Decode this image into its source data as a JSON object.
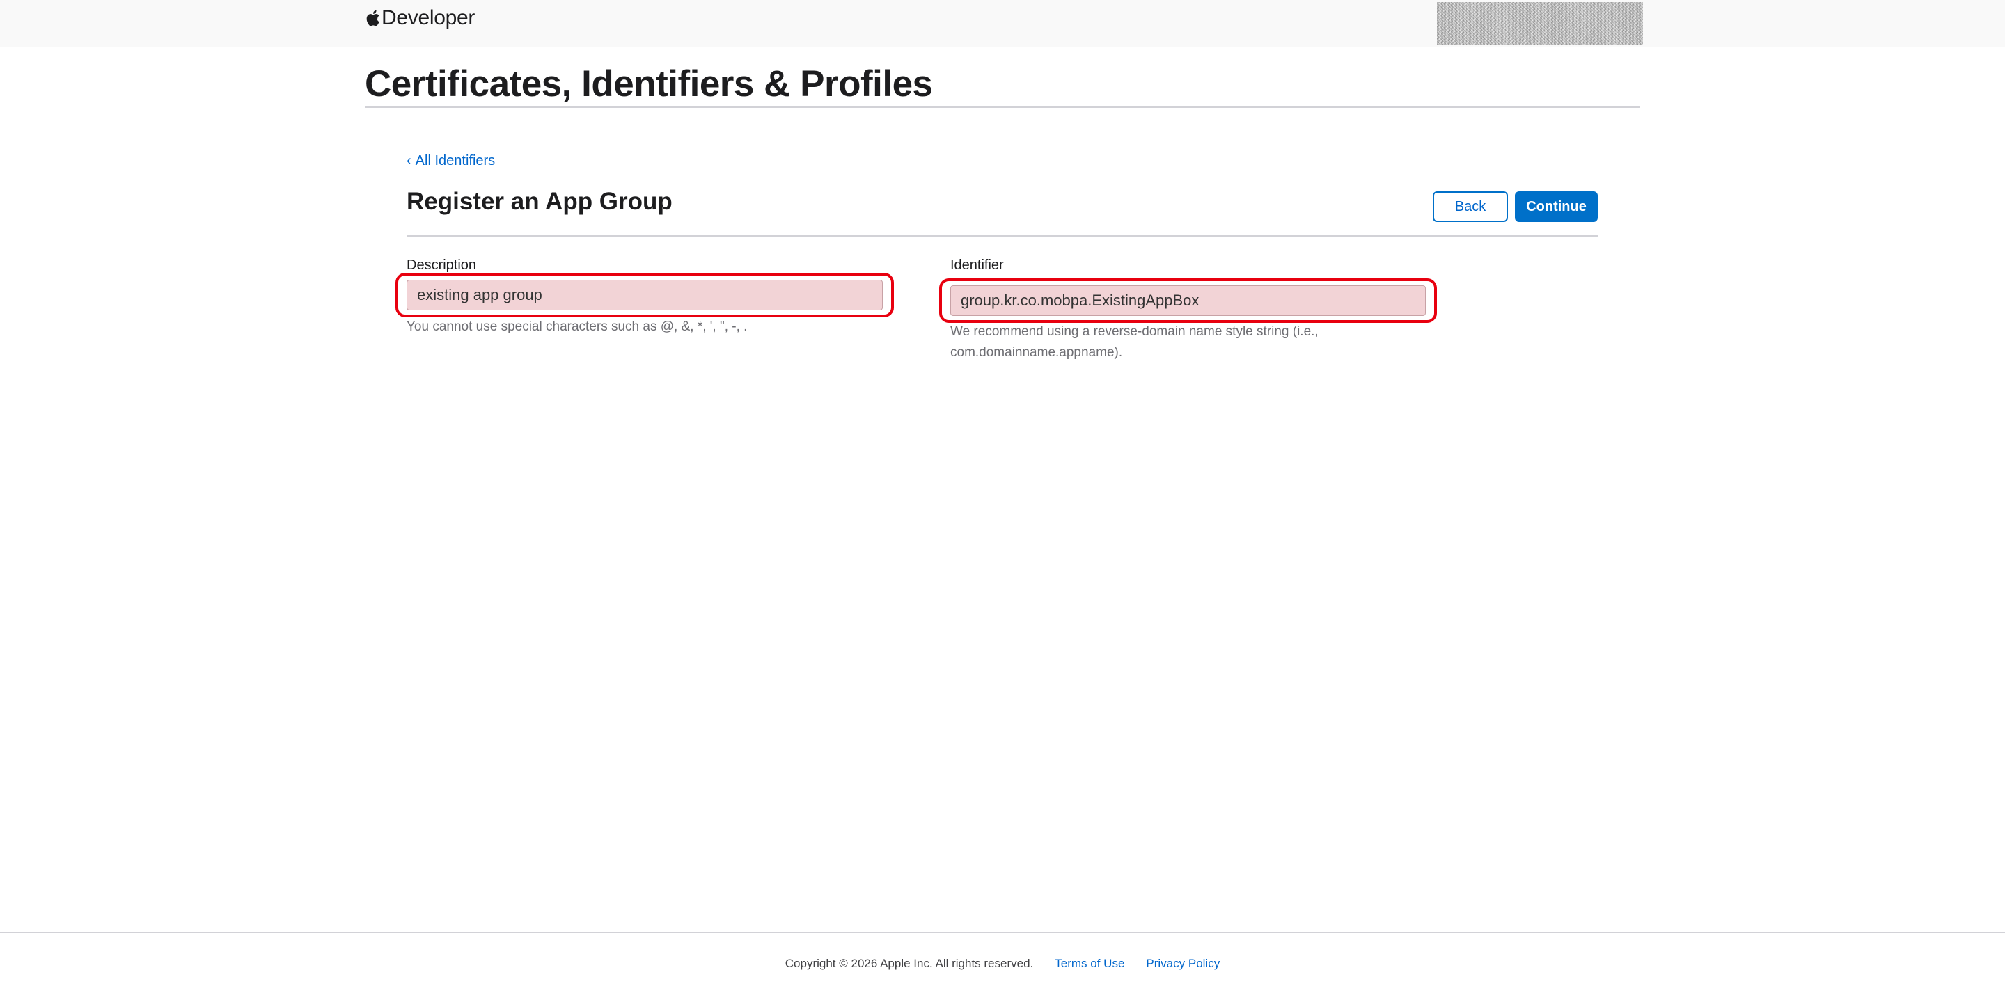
{
  "header": {
    "brand": "Developer",
    "icon": "apple-logo-icon"
  },
  "page": {
    "title": "Certificates, Identifiers & Profiles"
  },
  "content": {
    "back_link": "All Identifiers",
    "section_title": "Register an App Group",
    "buttons": {
      "back": "Back",
      "continue": "Continue"
    },
    "description": {
      "label": "Description",
      "value": "existing app group",
      "hint": "You cannot use special characters such as @, &, *, ', \", -, ."
    },
    "identifier": {
      "label": "Identifier",
      "value": "group.kr.co.mobpa.ExistingAppBox",
      "hint": "We recommend using a reverse-domain name style string (i.e., com.domainname.appname)."
    },
    "highlight_color": "#e8000f"
  },
  "footer": {
    "copyright": "Copyright © 2026 Apple Inc. All rights reserved.",
    "terms": "Terms of Use",
    "privacy": "Privacy Policy"
  }
}
